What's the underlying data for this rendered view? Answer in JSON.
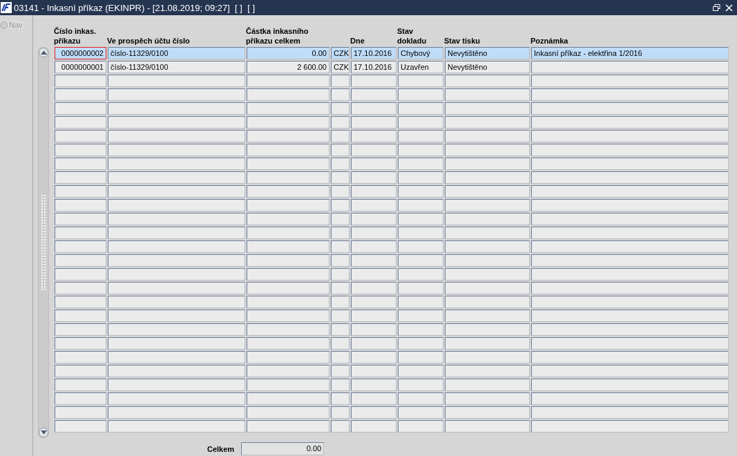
{
  "window": {
    "title": "03141 - Inkasní příkaz (EKINPR) - [21.08.2019; 09:27]  [ ]  [ ]"
  },
  "sidebar": {
    "nav_label": "Nav",
    "nav_selected": false
  },
  "table": {
    "columns": [
      {
        "line1": "Číslo inkas.",
        "line2": "příkazu"
      },
      {
        "line2": "Ve prospěch účtu číslo"
      },
      {
        "line1": "Částka inkasního",
        "line2": "příkazu celkem"
      },
      {},
      {
        "line2": "Dne"
      },
      {
        "line1": "Stav",
        "line2": "dokladu"
      },
      {
        "line2": "Stav tisku"
      },
      {
        "line2": "Poznámka"
      }
    ],
    "rows": [
      {
        "selected": true,
        "focused": true,
        "cells": [
          "0000000002",
          "číslo-11329/0100",
          "0.00",
          "CZK",
          "17.10.2016",
          "Chybový",
          "Nevytištěno",
          "Inkasní příkaz - elektřina 1/2016"
        ]
      },
      {
        "selected": false,
        "focused": false,
        "cells": [
          "0000000001",
          "číslo-11329/0100",
          "2 600.00",
          "CZK",
          "17.10.2016",
          "Uzavřen",
          "Nevytištěno",
          null
        ]
      }
    ]
  },
  "total": {
    "label": "Celkem",
    "value": "0.00"
  }
}
